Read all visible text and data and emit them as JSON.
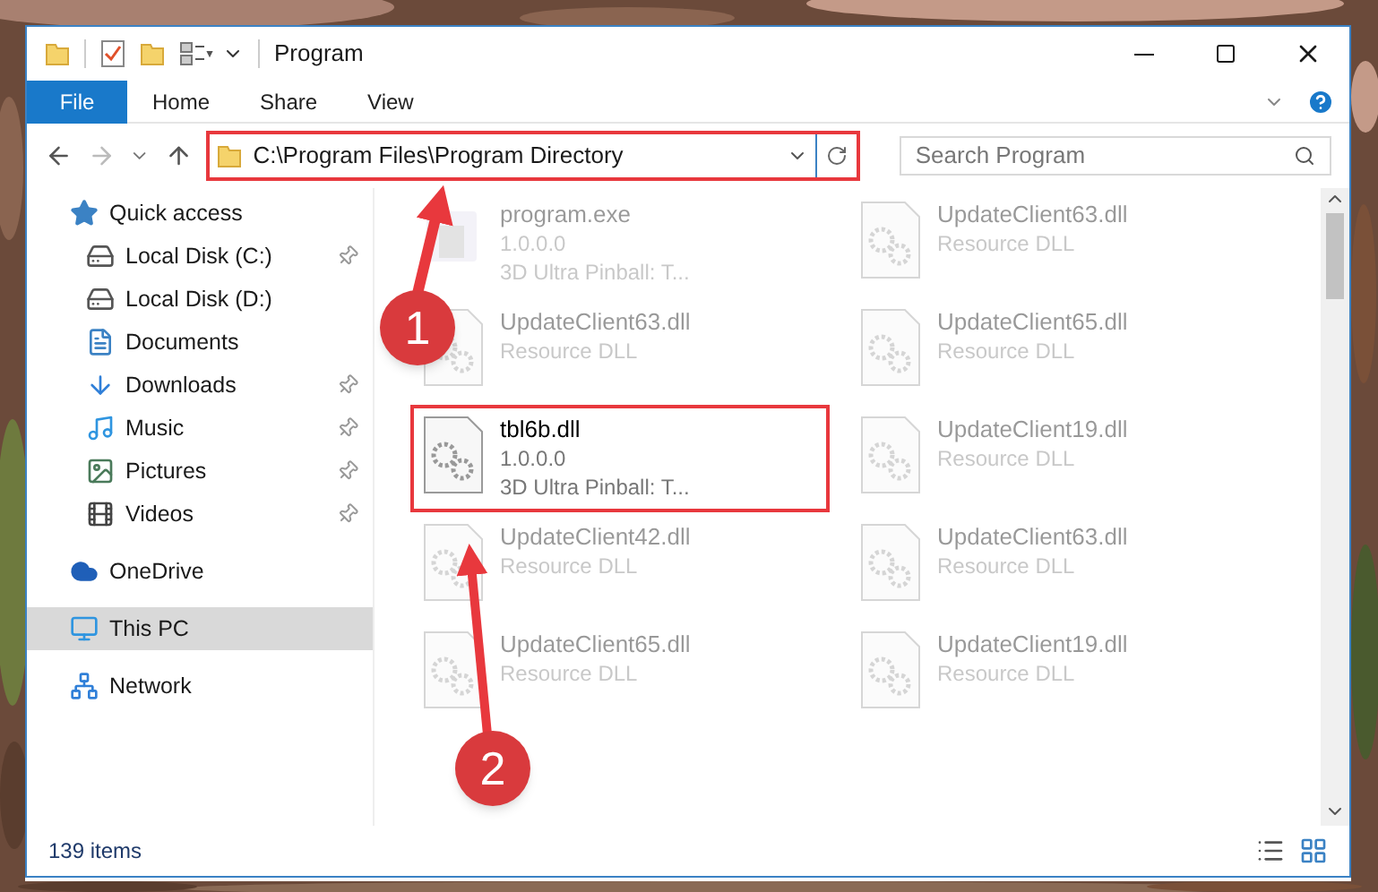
{
  "window": {
    "title": "Program"
  },
  "ribbon_tabs": [
    {
      "label": "File",
      "selected": true
    },
    {
      "label": "Home",
      "selected": false
    },
    {
      "label": "Share",
      "selected": false
    },
    {
      "label": "View",
      "selected": false
    }
  ],
  "address_bar": {
    "path": "C:\\Program Files\\Program Directory",
    "highlighted": true
  },
  "search": {
    "placeholder": "Search Program"
  },
  "sidebar": {
    "items": [
      {
        "label": "Quick access",
        "kind": "star",
        "selected": false,
        "children": [
          {
            "label": "Local Disk (C:)",
            "kind": "drive",
            "pinned": true,
            "selected": false
          },
          {
            "label": "Local Disk (D:)",
            "kind": "drive",
            "pinned": false,
            "selected": false
          },
          {
            "label": "Documents",
            "kind": "document",
            "pinned": false,
            "selected": false
          },
          {
            "label": "Downloads",
            "kind": "download",
            "pinned": true,
            "selected": false
          },
          {
            "label": "Music",
            "kind": "music",
            "pinned": true,
            "selected": false
          },
          {
            "label": "Pictures",
            "kind": "pictures",
            "pinned": true,
            "selected": false
          },
          {
            "label": "Videos",
            "kind": "videos",
            "pinned": true,
            "selected": false
          }
        ]
      },
      {
        "label": "OneDrive",
        "kind": "cloud",
        "selected": false
      },
      {
        "label": "This PC",
        "kind": "pc",
        "selected": true
      },
      {
        "label": "Network",
        "kind": "network",
        "selected": false
      }
    ]
  },
  "files": [
    {
      "name": "program.exe",
      "kind": "exe",
      "lines": [
        "1.0.0.0",
        "3D Ultra Pinball: T..."
      ],
      "highlighted": false
    },
    {
      "name": "UpdateClient63.dll",
      "kind": "dll",
      "lines": [
        "Resource DLL"
      ],
      "highlighted": false
    },
    {
      "name": "UpdateClient63.dll",
      "kind": "dll",
      "lines": [
        "Resource DLL"
      ],
      "highlighted": false
    },
    {
      "name": "UpdateClient65.dll",
      "kind": "dll",
      "lines": [
        "Resource DLL"
      ],
      "highlighted": false
    },
    {
      "name": "tbl6b.dll",
      "kind": "dll",
      "lines": [
        "1.0.0.0",
        "3D Ultra Pinball: T..."
      ],
      "highlighted": true
    },
    {
      "name": "UpdateClient19.dll",
      "kind": "dll",
      "lines": [
        "Resource DLL"
      ],
      "highlighted": false
    },
    {
      "name": "UpdateClient42.dll",
      "kind": "dll",
      "lines": [
        "Resource DLL"
      ],
      "highlighted": false
    },
    {
      "name": "UpdateClient63.dll",
      "kind": "dll",
      "lines": [
        "Resource DLL"
      ],
      "highlighted": false
    },
    {
      "name": "UpdateClient65.dll",
      "kind": "dll",
      "lines": [
        "Resource DLL"
      ],
      "highlighted": false
    },
    {
      "name": "UpdateClient19.dll",
      "kind": "dll",
      "lines": [
        "Resource DLL"
      ],
      "highlighted": false
    }
  ],
  "status_bar": {
    "count": "139 items"
  },
  "callouts": [
    {
      "number": "1"
    },
    {
      "number": "2"
    }
  ]
}
